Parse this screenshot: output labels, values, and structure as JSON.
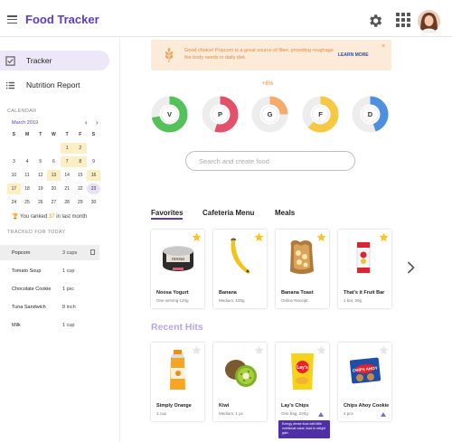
{
  "app": {
    "title": "Food Tracker"
  },
  "header": {
    "settings_icon": "gear-icon",
    "apps_icon": "grid-icon",
    "avatar_icon": "user-avatar"
  },
  "sidebar": {
    "items": [
      {
        "label": "Tracker",
        "icon": "checkbox-icon",
        "active": true
      },
      {
        "label": "Nutrition Report",
        "icon": "list-icon",
        "active": false
      }
    ],
    "calendar": {
      "section_label": "CALENDAR",
      "month": "March 2019",
      "prev": "‹",
      "next": "›",
      "weekdays": [
        "S",
        "M",
        "T",
        "W",
        "T",
        "F",
        "S"
      ],
      "rows": [
        [
          "",
          "",
          "",
          "",
          "1",
          "2",
          ""
        ],
        [
          "3",
          "4",
          "5",
          "6",
          "7",
          "8",
          "9"
        ],
        [
          "10",
          "11",
          "12",
          "13",
          "14",
          "15",
          "16"
        ],
        [
          "17",
          "18",
          "19",
          "20",
          "21",
          "22",
          "23"
        ],
        [
          "24",
          "25",
          "26",
          "27",
          "28",
          "29",
          "30"
        ]
      ]
    },
    "rank_prefix": "You ranked",
    "rank_value": "37",
    "rank_suffix": "in last month",
    "tracked_label": "TRACKED FOR TODAY",
    "tracked": [
      {
        "name": "Popcorn",
        "qty": "3 cups",
        "active": true
      },
      {
        "name": "Tomato Soup",
        "qty": "1 cup",
        "active": false
      },
      {
        "name": "Chocolate Cookie",
        "qty": "1 psc",
        "active": false
      },
      {
        "name": "Tuna Sandwich",
        "qty": "8 inch",
        "active": false
      },
      {
        "name": "Milk",
        "qty": "1 cup",
        "active": false
      }
    ]
  },
  "banner": {
    "message": "Good choice! Popcorn is a great source of fiber, providing roughage the body needs in daily diet.",
    "action": "LEARN MORE",
    "close": "×",
    "icon": "wheat-icon",
    "bg_color": "#fdebd9",
    "text_color": "#e38a3f"
  },
  "nutrients": {
    "change": "+8%",
    "rings": [
      {
        "letter": "V",
        "fraction": 0.72,
        "color": "#55c15a"
      },
      {
        "letter": "P",
        "fraction": 0.55,
        "color": "#e3506a"
      },
      {
        "letter": "G",
        "fraction": 0.25,
        "color": "#f5ac6b"
      },
      {
        "letter": "F",
        "fraction": 0.62,
        "color": "#f7c844"
      },
      {
        "letter": "D",
        "fraction": 0.45,
        "color": "#4f8fe0"
      }
    ]
  },
  "search": {
    "placeholder": "Search and create food"
  },
  "tabs": [
    "Favorites",
    "Cafeteria Menu",
    "Meals"
  ],
  "favorites": [
    {
      "name": "Noosa Yogurt",
      "sub": "One serving 120g",
      "starred": true
    },
    {
      "name": "Banana",
      "sub": "Medium, 100g",
      "starred": true
    },
    {
      "name": "Banana Toast",
      "sub": "Online Receipt",
      "starred": true
    },
    {
      "name": "That's it Fruit Bar",
      "sub": "1 bar, 30g",
      "starred": true
    }
  ],
  "recent_title": "Recent Hits",
  "recent": [
    {
      "name": "Simply Orange",
      "sub": "1 cup",
      "starred": false
    },
    {
      "name": "Kiwi",
      "sub": "Medium, 1 pc",
      "starred": false
    },
    {
      "name": "Lay's Chips",
      "sub": "One bag, 220g",
      "starred": false
    },
    {
      "name": "Chips Ahoy Cookie",
      "sub": "2 pcs",
      "starred": false
    }
  ],
  "tooltip": "Energy dense food with little nutritional value, lead to weight gain",
  "accent_color": "#5b3cc4",
  "star_color": "#f7c52b"
}
